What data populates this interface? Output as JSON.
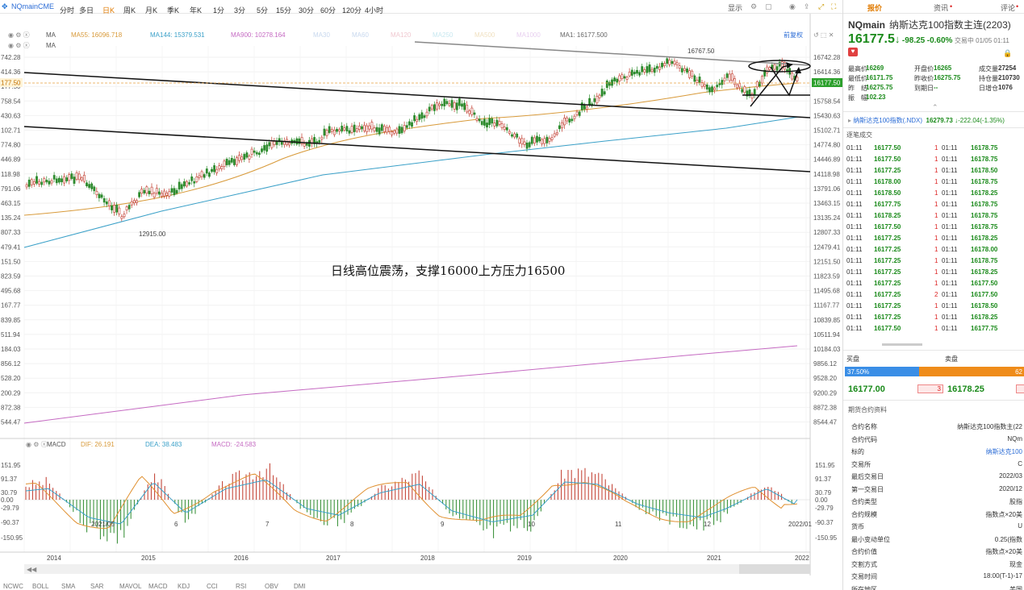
{
  "toolbar": {
    "symbol": "NQmainCME",
    "periods": [
      "分时",
      "多日",
      "日K",
      "周K",
      "月K",
      "季K",
      "年K",
      "1分",
      "3分",
      "5分",
      "15分",
      "30分",
      "60分",
      "120分",
      "4小时"
    ],
    "active_period": "日K",
    "right_items": [
      "显示"
    ]
  },
  "chart": {
    "ma_legend": {
      "ma55": "MA55: 16096.718",
      "ma144": "MA144: 15379.531",
      "ma900": "MA900: 10278.164",
      "ma30": "MA30",
      "ma60": "MA60",
      "ma120": "MA120",
      "ma250": "MA250",
      "ma500": "MA500",
      "ma1000": "MA1000",
      "ma1": "MA1: 16177.500",
      "ma_label": "MA",
      "ma_label2": "MA"
    },
    "adjust_label": "前复权",
    "left_ticks": [
      "742.28",
      "414.36",
      "177.50",
      "758.54",
      "430.63",
      "102.71",
      "774.80",
      "446.89",
      "118.98",
      "791.06",
      "463.15",
      "135.24",
      "807.33",
      "479.41",
      "151.50",
      "823.59",
      "495.68",
      "167.77",
      "839.85",
      "511.94",
      "184.03",
      "856.12",
      "528.20",
      "200.29",
      "872.38",
      "544.47"
    ],
    "right_ticks": [
      "16742.28",
      "16414.36",
      "15758.54",
      "15430.63",
      "15102.71",
      "14774.80",
      "14446.89",
      "14118.98",
      "13791.06",
      "13463.15",
      "13135.24",
      "12807.33",
      "12479.41",
      "12151.50",
      "11823.59",
      "11495.68",
      "11167.77",
      "10839.85",
      "10511.94",
      "10184.03",
      "9856.12",
      "9528.20",
      "9200.29",
      "8872.38",
      "8544.47"
    ],
    "current_price_left": "177.50",
    "current_price_right": "16177.50",
    "high_label": "16767.50",
    "low_label": "12915.00",
    "annotation": "日线高位震荡，支撑16000上方压力16500",
    "macd_legend": {
      "name": "MACD",
      "dif": "DIF: 26.191",
      "dea": "DEA: 38.483",
      "macd": "MACD: -24.583"
    },
    "macd_left_ticks": [
      "151.95",
      "91.37",
      "30.79",
      "0.00",
      "-29.79",
      "-90.37",
      "-150.95"
    ],
    "macd_right_ticks": [
      "151.95",
      "91.37",
      "30.79",
      "0.00",
      "-29.79",
      "-90.37",
      "-150.95"
    ],
    "xaxis": [
      "2014",
      "2021/05",
      "2015",
      "6",
      "2016",
      "7",
      "2017",
      "8",
      "2018",
      "9",
      "2019",
      "10",
      "2020",
      "11",
      "2021",
      "12",
      "2022/01",
      "2022"
    ],
    "bottom_items": [
      "NCWC",
      "BOLL",
      "SMA",
      "SAR",
      "MAVOL",
      "MACD",
      "KDJ",
      "CCI",
      "RSI",
      "OBV",
      "DMI"
    ]
  },
  "chart_data": {
    "type": "candlestick",
    "y_axis_range": [
      8544.47,
      16742.28
    ],
    "labeled_high": 16767.5,
    "labeled_low": 12915.0,
    "last": 16177.5,
    "indicators": {
      "MA55": 16096.718,
      "MA144": 15379.531,
      "MA900": 10278.164,
      "MA1": 16177.5,
      "DIF": 26.191,
      "DEA": 38.483,
      "MACD": -24.583
    }
  },
  "right": {
    "tabs": [
      "报价",
      "资讯",
      "评论"
    ],
    "code": "NQmain",
    "name": "纳斯达克100指数主连(2203)",
    "price": "16177.5",
    "arrow": "↓",
    "change": "-98.25",
    "change_pct": "-0.60%",
    "trade_time": "交易中 01/05 01:11",
    "stats": [
      {
        "k": "最高价",
        "v": "16269",
        "k2": "开盘价",
        "v2": "16265",
        "k3": "成交量",
        "v3": "27254"
      },
      {
        "k": "最低价",
        "v": "16171.75",
        "k2": "昨收价",
        "v2": "16275.75",
        "k3": "持仓量",
        "v3": "210730"
      },
      {
        "k": "昨　结",
        "v": "16275.75",
        "k2": "到期日",
        "v2": "--",
        "k3": "日增仓",
        "v3": "1076"
      },
      {
        "k": "振　幅",
        "v": "102.23",
        "k2": "",
        "v2": "",
        "k3": "",
        "v3": ""
      }
    ],
    "index_name": "纳斯达克100指数(.NDX)",
    "index_price": "16279.73",
    "index_change": "↓-222.04(-1.35%)",
    "ticks_title": "逐笔成交",
    "ticks": [
      [
        "01:11",
        "16177.50",
        "1",
        "01:11",
        "16178.75"
      ],
      [
        "01:11",
        "16177.50",
        "1",
        "01:11",
        "16178.75"
      ],
      [
        "01:11",
        "16177.25",
        "1",
        "01:11",
        "16178.50"
      ],
      [
        "01:11",
        "16178.00",
        "1",
        "01:11",
        "16178.75"
      ],
      [
        "01:11",
        "16178.50",
        "1",
        "01:11",
        "16178.25"
      ],
      [
        "01:11",
        "16177.75",
        "1",
        "01:11",
        "16178.75"
      ],
      [
        "01:11",
        "16178.25",
        "1",
        "01:11",
        "16178.75"
      ],
      [
        "01:11",
        "16177.50",
        "1",
        "01:11",
        "16178.75"
      ],
      [
        "01:11",
        "16177.25",
        "1",
        "01:11",
        "16178.25"
      ],
      [
        "01:11",
        "16177.25",
        "1",
        "01:11",
        "16178.00"
      ],
      [
        "01:11",
        "16177.25",
        "1",
        "01:11",
        "16178.75"
      ],
      [
        "01:11",
        "16177.25",
        "1",
        "01:11",
        "16178.25"
      ],
      [
        "01:11",
        "16177.25",
        "1",
        "01:11",
        "16177.50"
      ],
      [
        "01:11",
        "16177.25",
        "2",
        "01:11",
        "16177.50"
      ],
      [
        "01:11",
        "16177.25",
        "1",
        "01:11",
        "16178.50"
      ],
      [
        "01:11",
        "16177.25",
        "1",
        "01:11",
        "16178.25"
      ],
      [
        "01:11",
        "16177.50",
        "1",
        "01:11",
        "16177.75"
      ]
    ],
    "buy_label": "买盘",
    "sell_label": "卖盘",
    "buy_pct": "37.50%",
    "sell_pct": "62",
    "bid": "16177.00",
    "bid_size": "3",
    "ask": "16178.25",
    "contract_title": "期货合约资料",
    "contract": [
      {
        "k": "合约名称",
        "v": "纳斯达克100指数主(22"
      },
      {
        "k": "合约代码",
        "v": "NQm"
      },
      {
        "k": "标的",
        "v": "纳斯达克100"
      },
      {
        "k": "交易所",
        "v": "C"
      },
      {
        "k": "最后交易日",
        "v": "2022/03"
      },
      {
        "k": "第一交易日",
        "v": "2020/12"
      },
      {
        "k": "合约类型",
        "v": "股指"
      },
      {
        "k": "合约规模",
        "v": "指数点×20美"
      },
      {
        "k": "货币",
        "v": "U"
      },
      {
        "k": "最小变动单位",
        "v": "0.25(指数"
      },
      {
        "k": "合约价值",
        "v": "指数点×20美"
      },
      {
        "k": "交割方式",
        "v": "现金"
      },
      {
        "k": "交易时间",
        "v": "18:00(T-1)-17"
      },
      {
        "k": "所在地区",
        "v": "美国"
      }
    ]
  }
}
